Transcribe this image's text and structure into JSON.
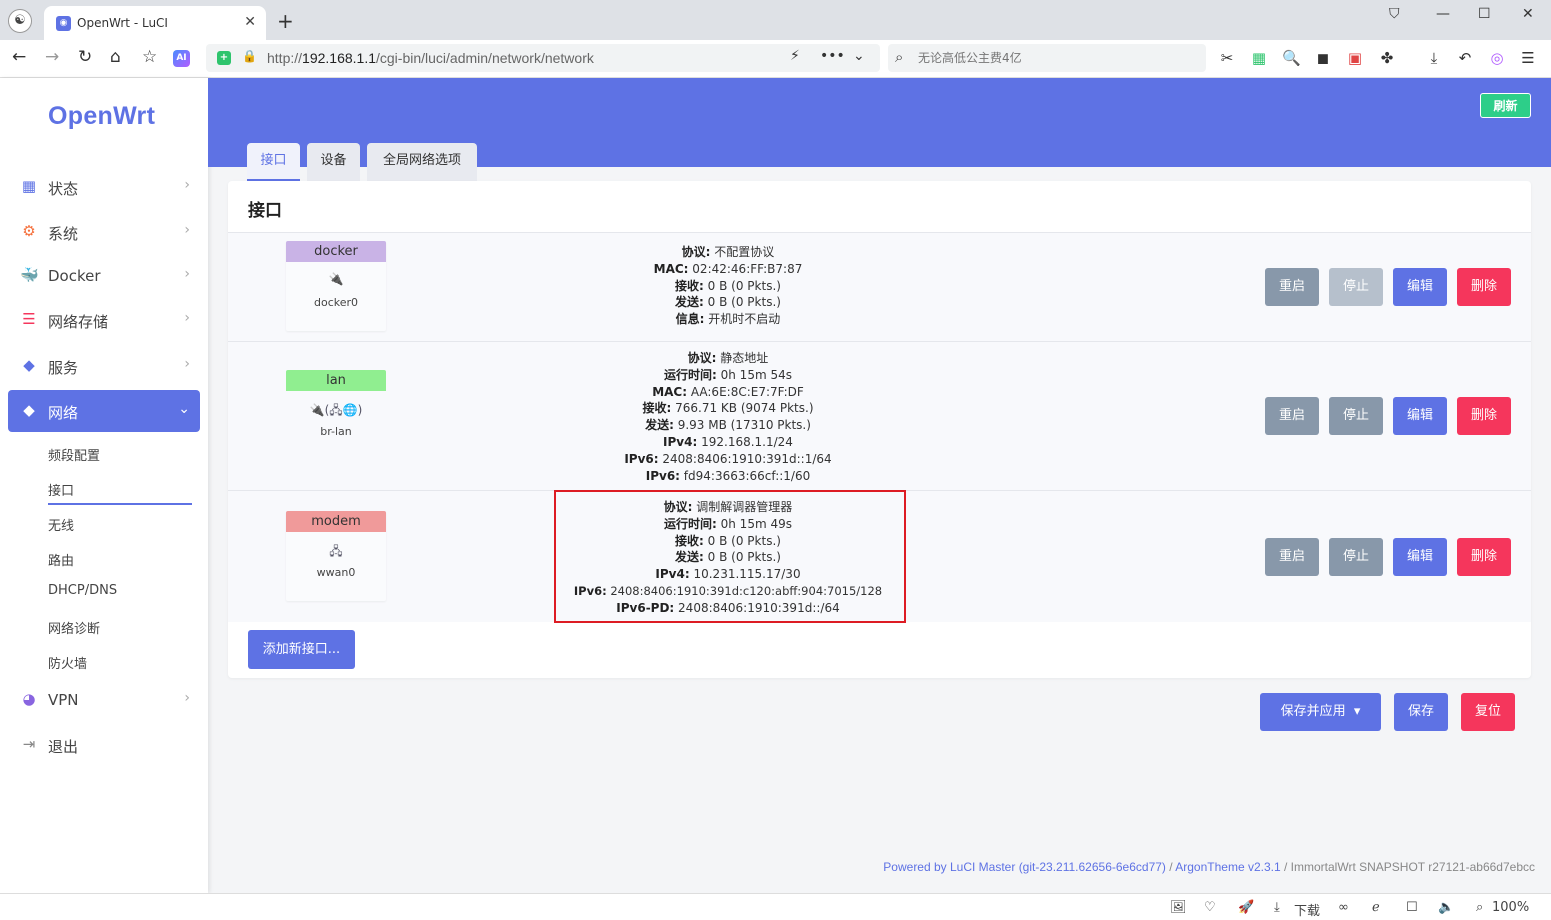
{
  "browser": {
    "tab_title": "OpenWrt - LuCI",
    "url_prefix": "http://",
    "url_host": "192.168.1.1",
    "url_path": "/cgi-bin/luci/admin/network/network",
    "search_placeholder": "无论高低公主费4亿",
    "ai_label": "AI",
    "zoom": "100%",
    "download_label": "下载"
  },
  "sidebar": {
    "brand": "OpenWrt",
    "items": [
      {
        "label": "状态",
        "icon": "dashboard-icon"
      },
      {
        "label": "系统",
        "icon": "gear-icon"
      },
      {
        "label": "Docker",
        "icon": "docker-icon"
      },
      {
        "label": "网络存储",
        "icon": "database-icon"
      },
      {
        "label": "服务",
        "icon": "cube-icon"
      },
      {
        "label": "网络",
        "icon": "network-cube-icon"
      },
      {
        "label": "VPN",
        "icon": "vpn-icon"
      },
      {
        "label": "退出",
        "icon": "logout-icon"
      }
    ],
    "sub_items": [
      "频段配置",
      "接口",
      "无线",
      "路由",
      "DHCP/DNS",
      "网络诊断",
      "防火墙"
    ]
  },
  "header": {
    "refresh": "刷新",
    "tabs": [
      "接口",
      "设备",
      "全局网络选项"
    ]
  },
  "panel": {
    "title": "接口",
    "add_button": "添加新接口...",
    "interfaces": [
      {
        "name": "docker",
        "color": "#c9b3e6",
        "device": "docker0",
        "icon_glyph": "🔌",
        "info": [
          {
            "k": "协议:",
            "v": " 不配置协议"
          },
          {
            "k": "MAC:",
            "v": " 02:42:46:FF:B7:87"
          },
          {
            "k": "接收:",
            "v": " 0 B (0 Pkts.)"
          },
          {
            "k": "发送:",
            "v": " 0 B (0 Pkts.)"
          },
          {
            "k": "信息:",
            "v": " 开机时不启动"
          }
        ]
      },
      {
        "name": "lan",
        "color": "#90ee90",
        "device": "br-lan",
        "icon_glyph": "🔌(🖧🌐)",
        "info": [
          {
            "k": "协议:",
            "v": " 静态地址"
          },
          {
            "k": "运行时间:",
            "v": " 0h 15m 54s"
          },
          {
            "k": "MAC:",
            "v": " AA:6E:8C:E7:7F:DF"
          },
          {
            "k": "接收:",
            "v": " 766.71 KB (9074 Pkts.)"
          },
          {
            "k": "发送:",
            "v": " 9.93 MB (17310 Pkts.)"
          },
          {
            "k": "IPv4:",
            "v": " 192.168.1.1/24"
          },
          {
            "k": "IPv6:",
            "v": " 2408:8406:1910:391d::1/64"
          },
          {
            "k": "IPv6:",
            "v": " fd94:3663:66cf::1/60"
          }
        ]
      },
      {
        "name": "modem",
        "color": "#f09a9a",
        "device": "wwan0",
        "icon_glyph": "🖧",
        "info": [
          {
            "k": "协议:",
            "v": " 调制解调器管理器"
          },
          {
            "k": "运行时间:",
            "v": " 0h 15m 49s"
          },
          {
            "k": "接收:",
            "v": " 0 B (0 Pkts.)"
          },
          {
            "k": "发送:",
            "v": " 0 B (0 Pkts.)"
          },
          {
            "k": "IPv4:",
            "v": " 10.231.115.17/30"
          },
          {
            "k": "IPv6:",
            "v": " 2408:8406:1910:391d:c120:abff:904:7015/128"
          },
          {
            "k": "IPv6-PD:",
            "v": " 2408:8406:1910:391d::/64"
          }
        ]
      }
    ],
    "actions": {
      "restart": "重启",
      "stop": "停止",
      "edit": "编辑",
      "delete": "删除"
    }
  },
  "bottom": {
    "save_apply": "保存并应用",
    "save_apply_caret": "▾",
    "save": "保存",
    "reset": "复位"
  },
  "footer": {
    "powered": "Powered by LuCI Master (git-23.211.62656-6e6cd77)",
    "sep1": " / ",
    "theme": "ArgonTheme v2.3.1",
    "sep2": " / ",
    "build": "ImmortalWrt SNAPSHOT r27121-ab66d7ebcc"
  }
}
